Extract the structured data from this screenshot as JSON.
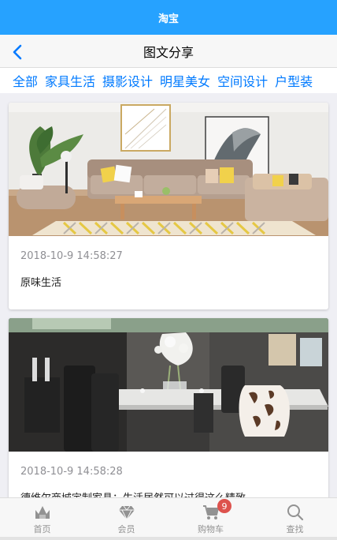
{
  "app": {
    "title": "淘宝",
    "accent_color": "#26a2ff"
  },
  "nav": {
    "title": "图文分享",
    "back_icon": "chevron-left-icon"
  },
  "categories": [
    "全部",
    "家具生活",
    "摄影设计",
    "明星美女",
    "空间设计",
    "户型装"
  ],
  "posts": [
    {
      "time": "2018-10-9 14:58:27",
      "title": "原味生活"
    },
    {
      "time": "2018-10-9 14:58:28",
      "title": "德维尔商城定制家具：生活居然可以过得这么精致"
    }
  ],
  "tabbar": {
    "tabs": [
      {
        "label": "首页",
        "icon": "home-icon"
      },
      {
        "label": "会员",
        "icon": "member-icon"
      },
      {
        "label": "购物车",
        "icon": "cart-icon",
        "badge": "9"
      },
      {
        "label": "查找",
        "icon": "search-icon"
      }
    ]
  }
}
